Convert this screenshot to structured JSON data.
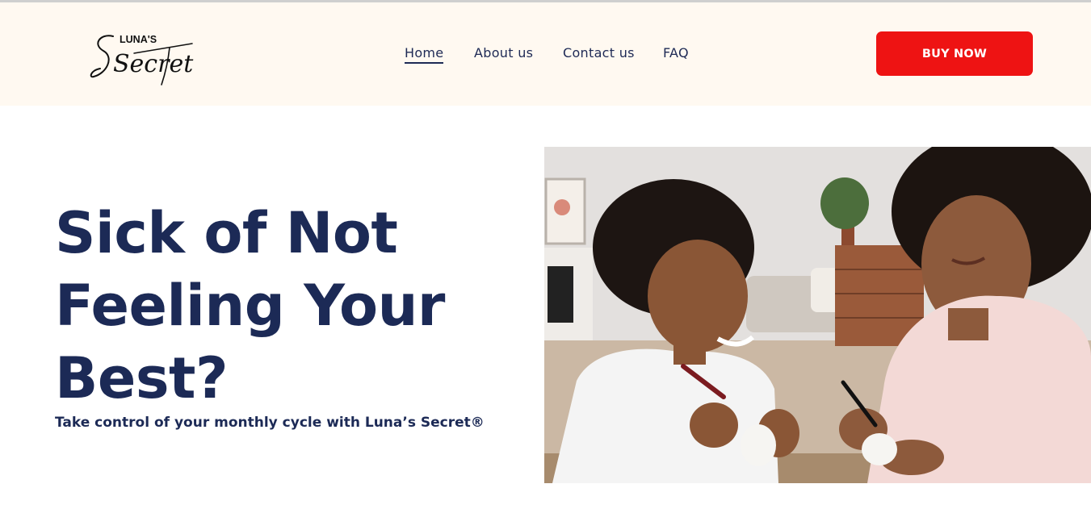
{
  "brand": {
    "logo_alt": "Luna's Secret",
    "logo_small": "LUNA'S",
    "logo_script": "Secret"
  },
  "nav": {
    "items": [
      {
        "label": "Home",
        "active": true
      },
      {
        "label": "About us",
        "active": false
      },
      {
        "label": "Contact us",
        "active": false
      },
      {
        "label": "FAQ",
        "active": false
      }
    ]
  },
  "header": {
    "buy_label": "BUY NOW"
  },
  "hero": {
    "headline": "Sick of Not Feeling Your Best?",
    "subheadline": "Take control of your monthly cycle with Luna’s Secret®",
    "image_alt": "A smiling boy and a woman drawing on white balls at a wooden table"
  },
  "colors": {
    "header_bg": "#fff9f1",
    "accent": "#ee1313",
    "navy": "#1c2a56"
  }
}
